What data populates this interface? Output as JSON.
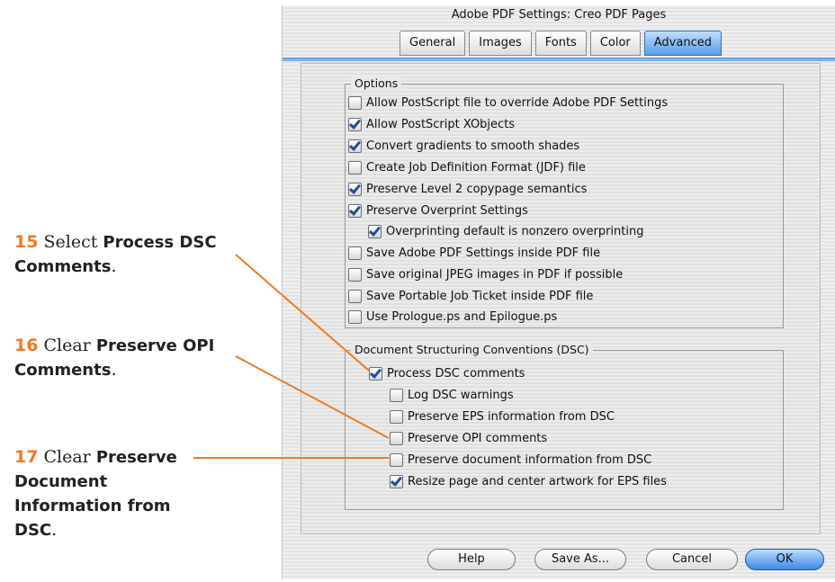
{
  "window": {
    "title": "Adobe PDF Settings: Creo PDF Pages"
  },
  "tabs": [
    {
      "label": "General"
    },
    {
      "label": "Images"
    },
    {
      "label": "Fonts"
    },
    {
      "label": "Color"
    },
    {
      "label": "Advanced",
      "active": true
    }
  ],
  "options_group": {
    "title": "Options",
    "items": [
      {
        "label": "Allow PostScript file to override Adobe PDF Settings",
        "checked": false
      },
      {
        "label": "Allow PostScript XObjects",
        "checked": true
      },
      {
        "label": "Convert gradients to smooth shades",
        "checked": true
      },
      {
        "label": "Create Job Definition Format (JDF) file",
        "checked": false
      },
      {
        "label": "Preserve Level 2 copypage semantics",
        "checked": true
      },
      {
        "label": "Preserve Overprint Settings",
        "checked": true
      },
      {
        "label": "Overprinting default is nonzero overprinting",
        "checked": true
      },
      {
        "label": "Save Adobe PDF Settings inside PDF file",
        "checked": false
      },
      {
        "label": "Save original JPEG images in PDF if possible",
        "checked": false
      },
      {
        "label": "Save Portable Job Ticket inside PDF file",
        "checked": false
      },
      {
        "label": "Use Prologue.ps and Epilogue.ps",
        "checked": false
      }
    ]
  },
  "dsc_group": {
    "title": "Document Structuring Conventions (DSC)",
    "items": [
      {
        "label": "Process DSC comments",
        "checked": true
      },
      {
        "label": "Log DSC warnings",
        "checked": false
      },
      {
        "label": "Preserve EPS information from DSC",
        "checked": false
      },
      {
        "label": "Preserve OPI comments",
        "checked": false
      },
      {
        "label": "Preserve document information from DSC",
        "checked": false
      },
      {
        "label": "Resize page and center artwork for EPS files",
        "checked": true
      }
    ]
  },
  "buttons": {
    "help": "Help",
    "save_as": "Save As...",
    "cancel": "Cancel",
    "ok": "OK"
  },
  "annotations": [
    {
      "number": "15",
      "verb": "Select",
      "bold": "Process DSC Comments",
      "end": "."
    },
    {
      "number": "16",
      "verb": "Clear",
      "bold": "Preserve OPI Comments",
      "end": "."
    },
    {
      "number": "17",
      "verb": "Clear",
      "bold": "Preserve Document Information from DSC",
      "end": "."
    }
  ],
  "colors": {
    "accent": "#f07a21",
    "tab_active": "#5a9fe8",
    "ok_button": "#3d8ae6"
  }
}
